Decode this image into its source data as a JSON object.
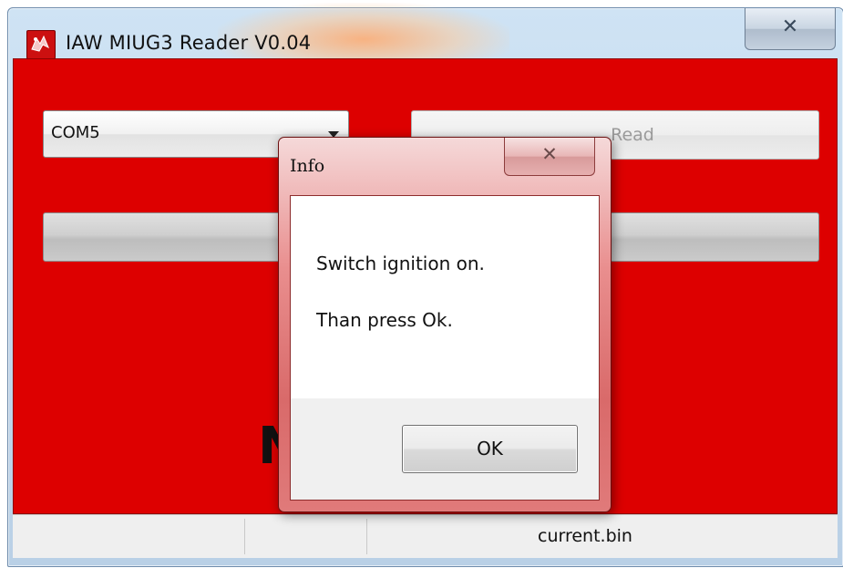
{
  "window": {
    "title": "IAW MIUG3 Reader V0.04",
    "close_glyph": "✕",
    "icon": "app-logo-icon"
  },
  "controls": {
    "com_port_value": "COM5",
    "read_button_label": "Read",
    "big_label_fragment": "N"
  },
  "status_bar": {
    "filename": "current.bin"
  },
  "dialog": {
    "title": "Info",
    "close_glyph": "✕",
    "message_line1": "Switch ignition on.",
    "message_line2": "Than press Ok.",
    "ok_label": "OK"
  },
  "colors": {
    "client_background": "#dd0000",
    "dialog_frame": "#d96a6a"
  }
}
